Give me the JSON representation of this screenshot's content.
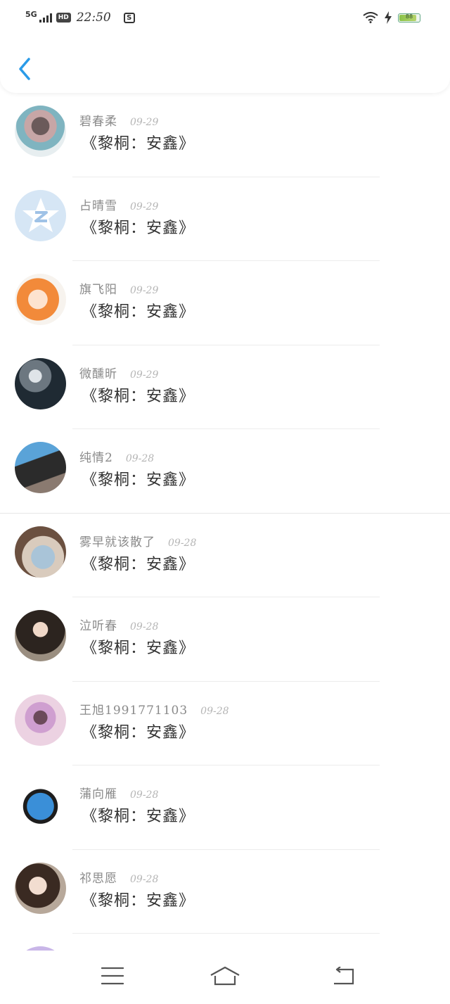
{
  "status_bar": {
    "signal": "5G",
    "hd": "HD",
    "time": "22:50",
    "s_badge": "S",
    "battery_label": "88",
    "battery_level": 0.88
  },
  "nav": {
    "back_icon": "chevron-left-icon"
  },
  "comments": [
    {
      "name": "碧春柔",
      "date": "09-29",
      "text": "《黎桐：安鑫》"
    },
    {
      "name": "占晴雪",
      "date": "09-29",
      "text": "《黎桐：安鑫》"
    },
    {
      "name": "旗飞阳",
      "date": "09-29",
      "text": "《黎桐：安鑫》"
    },
    {
      "name": "微醺昕",
      "date": "09-29",
      "text": "《黎桐：安鑫》"
    },
    {
      "name": "纯情2",
      "date": "09-28",
      "text": "《黎桐：安鑫》"
    },
    {
      "name": "雾早就该散了",
      "date": "09-28",
      "text": "《黎桐：安鑫》"
    },
    {
      "name": "泣听春",
      "date": "09-28",
      "text": "《黎桐：安鑫》"
    },
    {
      "name": "王旭1991771103",
      "date": "09-28",
      "text": "《黎桐：安鑫》"
    },
    {
      "name": "蒲向雁",
      "date": "09-28",
      "text": "《黎桐：安鑫》"
    },
    {
      "name": "祁思愿",
      "date": "09-28",
      "text": "《黎桐：安鑫》"
    }
  ],
  "bottom_nav": {
    "items": [
      {
        "icon": "menu-icon"
      },
      {
        "icon": "home-icon"
      },
      {
        "icon": "back-return-icon"
      }
    ]
  },
  "colors": {
    "accent": "#2a9be8",
    "name_text": "#8a8a8a",
    "date_text": "#b5b5b5",
    "body_text": "#333333"
  }
}
